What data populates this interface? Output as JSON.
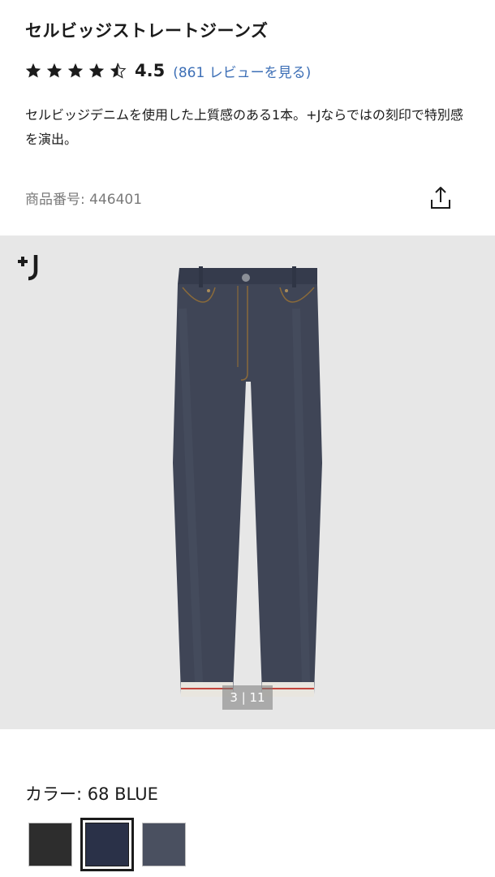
{
  "product": {
    "title": "セルビッジストレートジーンズ",
    "rating_value": "4.5",
    "rating_stars": 4.5,
    "review_link": "(861 レビューを見る)",
    "description": "セルビッジデニムを使用した上質感のある1本。+Jならではの刻印で特別感を演出。",
    "product_number": "商品番号: 446401"
  },
  "gallery": {
    "brand_logo": "+J",
    "counter": "3 | 11"
  },
  "color": {
    "label": "カラー: 68 BLUE",
    "swatches": [
      {
        "name": "black",
        "color": "#2d2d2d",
        "selected": false
      },
      {
        "name": "navy",
        "color": "#2a3148",
        "selected": true
      },
      {
        "name": "blue",
        "color": "#4a5060",
        "selected": false
      }
    ]
  },
  "colors": {
    "link": "#3d6fb6",
    "image_bg": "#e7e7e7",
    "denim": "#3f4556"
  }
}
